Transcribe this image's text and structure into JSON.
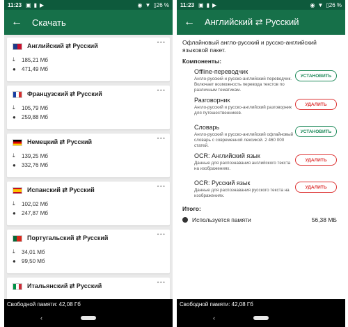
{
  "left": {
    "status": {
      "time": "11:23",
      "battery": "26 %"
    },
    "appbar": {
      "title": "Скачать"
    },
    "cards": [
      {
        "flag": "en",
        "pair": "Английский ⇄ Русский",
        "size_download": "185,21 Мб",
        "size_installed": "471,49 Мб"
      },
      {
        "flag": "fr",
        "pair": "Французский ⇄ Русский",
        "size_download": "105,79 Мб",
        "size_installed": "259,88 Мб"
      },
      {
        "flag": "de",
        "pair": "Немецкий ⇄ Русский",
        "size_download": "139,25 Мб",
        "size_installed": "332,76 Мб"
      },
      {
        "flag": "es",
        "pair": "Испанский ⇄ Русский",
        "size_download": "102,02 Мб",
        "size_installed": "247,87 Мб"
      },
      {
        "flag": "pt",
        "pair": "Португальский ⇄ Русский",
        "size_download": "34,01 Мб",
        "size_installed": "99,50 Мб"
      },
      {
        "flag": "it",
        "pair": "Итальянский ⇄ Русский",
        "size_download": "",
        "size_installed": ""
      }
    ],
    "footer": {
      "free_memory": "Свободной памяти: 42,08 Гб"
    }
  },
  "right": {
    "status": {
      "time": "11:23",
      "battery": "26 %"
    },
    "appbar": {
      "title": "Английский ⇄ Русский"
    },
    "description": "Офлайновый англо-русский и русско-английский языковой пакет.",
    "components_title": "Компоненты:",
    "components": [
      {
        "name": "Offline-переводчик",
        "desc": "Англо-русский и русско-английский переводчик. Включает возможность перевода текстов по различным тематикам.",
        "action": "УСТАНОВИТЬ",
        "kind": "install"
      },
      {
        "name": "Разговорник",
        "desc": "Англо-русский и русско-английский разговорник для путешественников.",
        "action": "УДАЛИТЬ",
        "kind": "delete"
      },
      {
        "name": "Словарь",
        "desc": "Англо-русский и русско-английский офлайновый словарь с современной лексикой. 2 460 000 статей.",
        "action": "УСТАНОВИТЬ",
        "kind": "install"
      },
      {
        "name": "OCR: Английский язык",
        "desc": "Данные для распознавания английского текста на изображениях.",
        "action": "УДАЛИТЬ",
        "kind": "delete"
      },
      {
        "name": "OCR: Русский язык",
        "desc": "Данные для распознавания русского текста на изображениях.",
        "action": "УДАЛИТЬ",
        "kind": "delete"
      }
    ],
    "total_title": "Итого:",
    "memory_label": "Используется памяти",
    "memory_value": "56,38 МБ",
    "footer": {
      "free_memory": "Свободной памяти: 42,08 Гб"
    }
  },
  "colors": {
    "statusbar": "#0e5a3c",
    "appbar": "#167049",
    "install": "#1e8a5a",
    "delete": "#dd3333"
  },
  "icons": {
    "back": "arrow-left-icon",
    "download": "download-icon",
    "installed": "disk-icon",
    "more": "more-dots-icon"
  }
}
